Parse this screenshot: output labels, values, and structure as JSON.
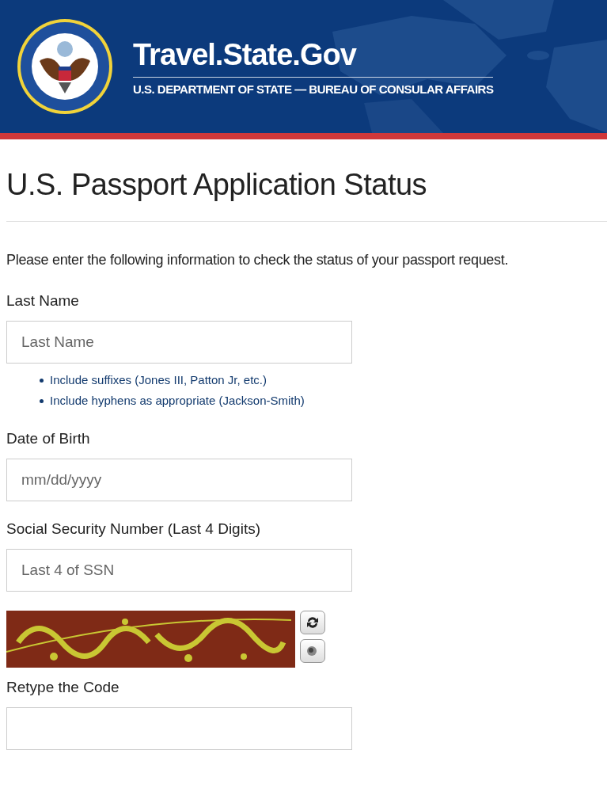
{
  "header": {
    "site_title": "Travel.State.Gov",
    "subtitle": "U.S. DEPARTMENT OF STATE — BUREAU OF CONSULAR AFFAIRS"
  },
  "page_title": "U.S. Passport Application Status",
  "intro": "Please enter the following information to check the status of your passport request.",
  "fields": [
    {
      "label": "Last Name",
      "placeholder": "Last Name",
      "hints": [
        "Include suffixes (Jones III, Patton Jr, etc.)",
        "Include hyphens as appropriate (Jackson-Smith)"
      ]
    },
    {
      "label": "Date of Birth",
      "placeholder": "mm/dd/yyyy"
    },
    {
      "label": "Social Security Number (Last 4 Digits)",
      "placeholder": "Last 4 of SSN"
    }
  ],
  "captcha": {
    "kind": "picture",
    "label": "Retype the Code"
  }
}
